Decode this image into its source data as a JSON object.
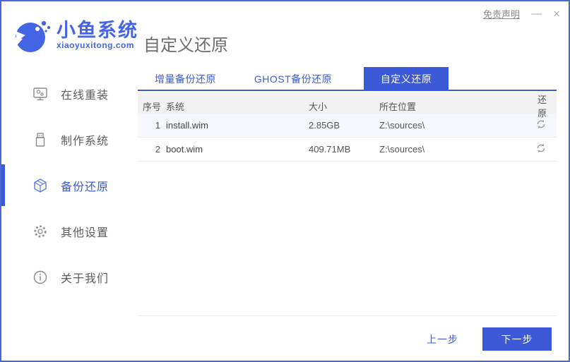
{
  "window": {
    "disclaimer": "免责声明",
    "minimize": "—",
    "close": "×"
  },
  "header": {
    "logo_title": "小鱼系统",
    "logo_subtitle": "xiaoyuxitong.com",
    "page_title": "自定义还原"
  },
  "sidebar": {
    "items": [
      {
        "label": "在线重装",
        "icon": "monitor-icon",
        "active": false
      },
      {
        "label": "制作系统",
        "icon": "usb-drive-icon",
        "active": false
      },
      {
        "label": "备份还原",
        "icon": "backup-cube-icon",
        "active": true
      },
      {
        "label": "其他设置",
        "icon": "gear-icon",
        "active": false
      },
      {
        "label": "关于我们",
        "icon": "info-icon",
        "active": false
      }
    ]
  },
  "tabs": {
    "items": [
      {
        "label": "增量备份还原",
        "active": false
      },
      {
        "label": "GHOST备份还原",
        "active": false
      },
      {
        "label": "自定义还原",
        "active": true
      }
    ]
  },
  "table": {
    "headers": {
      "index": "序号",
      "system": "系统",
      "size": "大小",
      "location": "所在位置",
      "restore": "还原"
    },
    "rows": [
      {
        "index": "1",
        "system": "install.wim",
        "size": "2.85GB",
        "location": "Z:\\sources\\"
      },
      {
        "index": "2",
        "system": "boot.wim",
        "size": "409.71MB",
        "location": "Z:\\sources\\"
      }
    ]
  },
  "footer": {
    "prev_label": "上一步",
    "next_label": "下一步"
  },
  "colors": {
    "primary_blue": "#3c5ad8",
    "logo_blue": "#4464e4",
    "window_border": "#4866d6",
    "table_header_bg": "#f2f2f2",
    "row_alt_bg": "#f6f8fd",
    "muted_text": "#8a8a8a"
  }
}
